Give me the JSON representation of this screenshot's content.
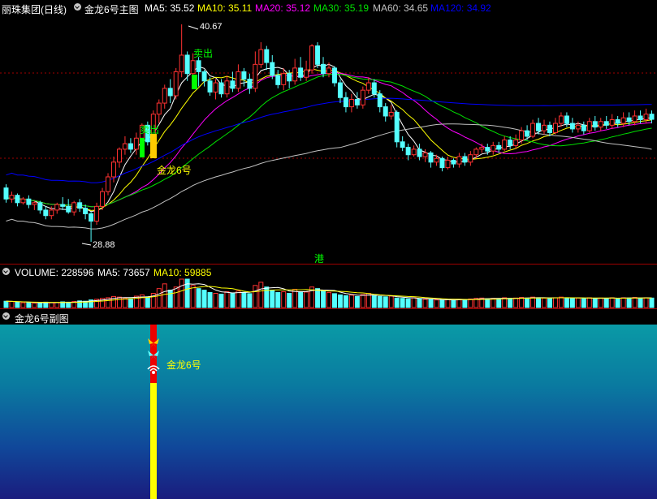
{
  "main_header": {
    "stock_name": "丽珠集团(日线)",
    "indicator": "金龙6号主图",
    "ma5": "MA5: 35.52",
    "ma10": "MA10: 35.11",
    "ma20": "MA20: 35.12",
    "ma30": "MA30: 35.19",
    "ma60": "MA60: 34.65",
    "ma120": "MA120: 34.92"
  },
  "annotations": {
    "high_price": "40.67",
    "low_price": "28.88",
    "sell_label_1": "卖出",
    "sell_label_2": "卖出",
    "signal_label": "金龙6号",
    "hk_marker": "港"
  },
  "volume_header": {
    "volume": "VOLUME: 228596",
    "ma5": "MA5: 73657",
    "ma10": "MA10: 59885"
  },
  "sub_header": {
    "title": "金龙6号副图",
    "signal_label": "金龙6号"
  },
  "colors": {
    "up": "#ff3232",
    "down": "#54ffff",
    "ma5": "#ffffff",
    "ma10": "#ffff00",
    "ma20": "#ff00ff",
    "ma30": "#00e000",
    "ma60": "#c0c0c0",
    "ma120": "#0000ff",
    "grid": "#a00000"
  },
  "chart_data": {
    "type": "candlestick",
    "price_high": 40.67,
    "price_low": 28.88,
    "candles": [
      [
        31.8,
        31.2,
        32.0,
        31.0
      ],
      [
        31.2,
        31.4,
        31.6,
        31.0
      ],
      [
        31.4,
        31.0,
        31.5,
        30.8
      ],
      [
        31.0,
        31.2,
        31.3,
        30.9
      ],
      [
        31.2,
        30.9,
        31.4,
        30.7
      ],
      [
        30.9,
        31.0,
        31.1,
        30.6
      ],
      [
        31.0,
        30.6,
        31.1,
        30.4
      ],
      [
        30.6,
        30.3,
        30.8,
        30.1
      ],
      [
        30.3,
        30.6,
        30.8,
        30.1
      ],
      [
        30.6,
        30.9,
        31.0,
        30.4
      ],
      [
        30.9,
        30.8,
        31.3,
        30.6
      ],
      [
        30.8,
        30.5,
        31.2,
        30.4
      ],
      [
        30.5,
        31.0,
        31.1,
        30.3
      ],
      [
        31.0,
        30.7,
        31.2,
        30.5
      ],
      [
        30.7,
        30.4,
        30.9,
        30.1
      ],
      [
        30.4,
        30.0,
        30.5,
        28.88
      ],
      [
        30.0,
        30.8,
        31.0,
        29.8
      ],
      [
        30.8,
        31.6,
        31.8,
        30.6
      ],
      [
        31.6,
        32.4,
        32.6,
        31.4
      ],
      [
        32.4,
        33.2,
        33.5,
        32.1
      ],
      [
        33.2,
        33.9,
        34.0,
        32.9
      ],
      [
        33.9,
        34.2,
        34.6,
        33.6
      ],
      [
        34.2,
        33.9,
        34.5,
        33.7
      ],
      [
        33.9,
        34.5,
        34.8,
        33.6
      ],
      [
        34.5,
        35.2,
        35.3,
        34.3
      ],
      [
        35.2,
        34.3,
        35.4,
        34.1
      ],
      [
        34.3,
        35.8,
        36.0,
        34.2
      ],
      [
        35.8,
        36.4,
        36.6,
        35.3
      ],
      [
        36.4,
        37.2,
        37.4,
        36.1
      ],
      [
        37.2,
        36.8,
        37.7,
        36.4
      ],
      [
        36.8,
        38.1,
        38.3,
        36.6
      ],
      [
        38.1,
        39.0,
        40.67,
        37.8
      ],
      [
        39.0,
        38.0,
        39.2,
        37.6
      ],
      [
        38.0,
        38.7,
        39.1,
        37.7
      ],
      [
        38.7,
        38.1,
        38.9,
        37.3
      ],
      [
        38.1,
        37.6,
        38.2,
        37.3
      ],
      [
        37.6,
        37.0,
        37.8,
        36.8
      ],
      [
        37.0,
        37.5,
        37.7,
        36.6
      ],
      [
        37.5,
        36.9,
        37.7,
        36.7
      ],
      [
        36.9,
        37.6,
        37.9,
        36.7
      ],
      [
        37.6,
        37.2,
        38.1,
        37.0
      ],
      [
        37.2,
        38.1,
        38.5,
        37.0
      ],
      [
        38.1,
        37.7,
        38.3,
        37.3
      ],
      [
        37.7,
        37.2,
        38.0,
        36.9
      ],
      [
        37.2,
        38.5,
        39.2,
        37.0
      ],
      [
        38.5,
        39.3,
        39.7,
        38.3
      ],
      [
        39.3,
        38.6,
        39.5,
        38.2
      ],
      [
        38.6,
        37.9,
        39.0,
        37.7
      ],
      [
        37.9,
        37.4,
        38.2,
        37.2
      ],
      [
        37.4,
        38.0,
        38.3,
        37.1
      ],
      [
        38.0,
        37.6,
        38.2,
        37.2
      ],
      [
        37.6,
        38.3,
        38.8,
        37.4
      ],
      [
        38.3,
        37.8,
        38.9,
        37.6
      ],
      [
        37.8,
        38.2,
        38.7,
        37.6
      ],
      [
        38.2,
        39.5,
        39.6,
        38.0
      ],
      [
        39.5,
        38.5,
        39.7,
        38.3
      ],
      [
        38.5,
        38.0,
        38.9,
        37.8
      ],
      [
        38.0,
        38.3,
        38.6,
        37.8
      ],
      [
        38.3,
        37.5,
        38.4,
        37.3
      ],
      [
        37.5,
        36.7,
        37.7,
        36.4
      ],
      [
        36.7,
        36.2,
        37.0,
        35.9
      ],
      [
        36.2,
        36.6,
        36.9,
        35.9
      ],
      [
        36.6,
        36.3,
        37.0,
        36.1
      ],
      [
        36.3,
        37.1,
        37.3,
        36.1
      ],
      [
        37.1,
        37.5,
        37.8,
        36.9
      ],
      [
        37.5,
        36.9,
        37.7,
        36.7
      ],
      [
        36.9,
        36.2,
        37.1,
        35.9
      ],
      [
        36.2,
        35.7,
        36.4,
        35.4
      ],
      [
        35.7,
        35.9,
        36.3,
        35.5
      ],
      [
        35.9,
        34.3,
        36.0,
        34.0
      ],
      [
        34.3,
        34.0,
        34.6,
        33.8
      ],
      [
        34.0,
        33.6,
        34.2,
        33.3
      ],
      [
        33.6,
        33.9,
        34.1,
        33.5
      ],
      [
        33.9,
        33.5,
        34.2,
        33.3
      ],
      [
        33.5,
        33.7,
        33.9,
        33.2
      ],
      [
        33.7,
        33.2,
        33.8,
        32.9
      ],
      [
        33.2,
        33.4,
        33.6,
        33.0
      ],
      [
        33.4,
        32.9,
        33.5,
        32.7
      ],
      [
        32.9,
        33.3,
        33.5,
        32.8
      ],
      [
        33.3,
        33.1,
        33.4,
        32.9
      ],
      [
        33.1,
        33.5,
        33.7,
        32.9
      ],
      [
        33.5,
        33.2,
        33.7,
        33.0
      ],
      [
        33.2,
        33.6,
        33.8,
        33.0
      ],
      [
        33.6,
        33.9,
        34.0,
        33.4
      ],
      [
        33.9,
        34.0,
        34.2,
        33.7
      ],
      [
        34.0,
        33.8,
        34.2,
        33.6
      ],
      [
        33.8,
        34.1,
        34.3,
        33.6
      ],
      [
        34.1,
        33.9,
        34.3,
        33.7
      ],
      [
        33.9,
        34.4,
        34.6,
        33.8
      ],
      [
        34.4,
        34.1,
        34.6,
        33.9
      ],
      [
        34.1,
        34.4,
        34.7,
        33.9
      ],
      [
        34.4,
        34.9,
        35.1,
        34.2
      ],
      [
        34.9,
        34.6,
        35.2,
        34.4
      ],
      [
        34.6,
        35.3,
        35.5,
        34.5
      ],
      [
        35.3,
        34.9,
        35.6,
        34.7
      ],
      [
        34.9,
        35.2,
        35.5,
        34.7
      ],
      [
        35.2,
        34.8,
        35.4,
        34.6
      ],
      [
        34.8,
        35.3,
        35.6,
        34.7
      ],
      [
        35.3,
        35.7,
        35.9,
        35.1
      ],
      [
        35.7,
        35.3,
        35.9,
        35.1
      ],
      [
        35.3,
        35.0,
        35.6,
        34.8
      ],
      [
        35.0,
        35.2,
        35.4,
        34.8
      ],
      [
        35.2,
        34.9,
        35.4,
        34.7
      ],
      [
        34.9,
        35.4,
        35.6,
        34.8
      ],
      [
        35.4,
        35.1,
        35.7,
        34.9
      ],
      [
        35.1,
        35.4,
        35.6,
        34.9
      ],
      [
        35.4,
        35.2,
        35.7,
        35.0
      ],
      [
        35.2,
        35.5,
        35.8,
        35.0
      ],
      [
        35.5,
        35.3,
        35.7,
        35.1
      ],
      [
        35.3,
        35.6,
        35.9,
        35.1
      ],
      [
        35.6,
        35.4,
        35.9,
        35.2
      ],
      [
        35.4,
        35.7,
        36.0,
        35.2
      ],
      [
        35.7,
        35.5,
        36.0,
        35.3
      ],
      [
        35.5,
        35.8,
        36.1,
        35.3
      ],
      [
        35.8,
        35.52,
        36.0,
        35.3
      ]
    ],
    "volumes": [
      40,
      38,
      35,
      30,
      32,
      28,
      30,
      34,
      30,
      32,
      36,
      34,
      38,
      42,
      40,
      48,
      52,
      58,
      62,
      70,
      66,
      60,
      56,
      72,
      80,
      68,
      90,
      120,
      150,
      110,
      130,
      228596,
      180,
      140,
      120,
      110,
      95,
      90,
      85,
      100,
      92,
      105,
      96,
      88,
      140,
      160,
      130,
      110,
      95,
      100,
      90,
      115,
      100,
      98,
      130,
      120,
      105,
      96,
      88,
      80,
      75,
      78,
      70,
      82,
      90,
      74,
      70,
      68,
      72,
      60,
      58,
      55,
      62,
      56,
      52,
      50,
      48,
      46,
      50,
      48,
      52,
      50,
      54,
      58,
      60,
      56,
      58,
      55,
      62,
      58,
      60,
      64,
      60,
      66,
      62,
      60,
      58,
      62,
      66,
      62,
      58,
      60,
      56,
      62,
      58,
      60,
      58,
      62,
      58,
      62,
      60,
      64,
      60,
      62,
      60
    ]
  }
}
